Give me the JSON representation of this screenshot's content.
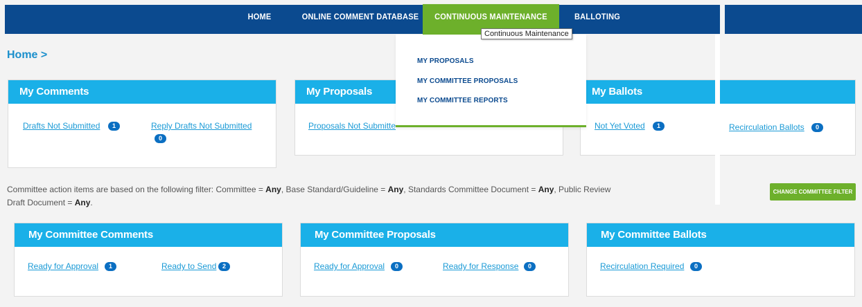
{
  "nav": {
    "items": [
      {
        "label": "HOME"
      },
      {
        "label": "ONLINE COMMENT DATABASE"
      },
      {
        "label": "CONTINUOUS MAINTENANCE"
      },
      {
        "label": "BALLOTING"
      }
    ]
  },
  "tooltip": "Continuous Maintenance",
  "dropdown": {
    "items": [
      "MY PROPOSALS",
      "MY COMMITTEE PROPOSALS",
      "MY COMMITTEE REPORTS"
    ]
  },
  "breadcrumb": "Home >",
  "my_comments": {
    "title": "My Comments",
    "drafts_label": "Drafts Not Submitted",
    "drafts_count": "1",
    "reply_label": "Reply Drafts Not Submitted",
    "reply_count": "0"
  },
  "my_proposals": {
    "title": "My Proposals",
    "link_label": "Proposals Not Submitte"
  },
  "my_ballots": {
    "title": "My Ballots",
    "not_voted_label": "Not Yet Voted",
    "not_voted_count": "1",
    "recirc_label": "Recirculation Ballots",
    "recirc_count": "0"
  },
  "filter": {
    "prefix": "Committee action items are based on the following filter: Committee = ",
    "committee": "Any",
    "base_label": ", Base Standard/Guideline = ",
    "base_value": "Any",
    "scd_label": ", Standards Committee Document = ",
    "scd_value": "Any",
    "public_label": ", Public Review Draft Document = ",
    "public_value": "Any",
    "suffix": ".",
    "button": "CHANGE COMMITTEE FILTER"
  },
  "committee_comments": {
    "title": "My Committee Comments",
    "ready_approval_label": "Ready for Approval",
    "ready_approval_count": "1",
    "ready_send_label": "Ready to Send",
    "ready_send_count": "2"
  },
  "committee_proposals": {
    "title": "My Committee Proposals",
    "ready_approval_label": "Ready for Approval",
    "ready_approval_count": "0",
    "ready_response_label": "Ready for Response",
    "ready_response_count": "0"
  },
  "committee_ballots": {
    "title": "My Committee Ballots",
    "recirc_label": "Recirculation Required",
    "recirc_count": "0"
  },
  "colors": {
    "nav_bg": "#0b4a8f",
    "nav_active": "#6db02b",
    "card_head": "#1ab0e8",
    "link": "#1a9ad6",
    "badge": "#0b6fc2"
  }
}
